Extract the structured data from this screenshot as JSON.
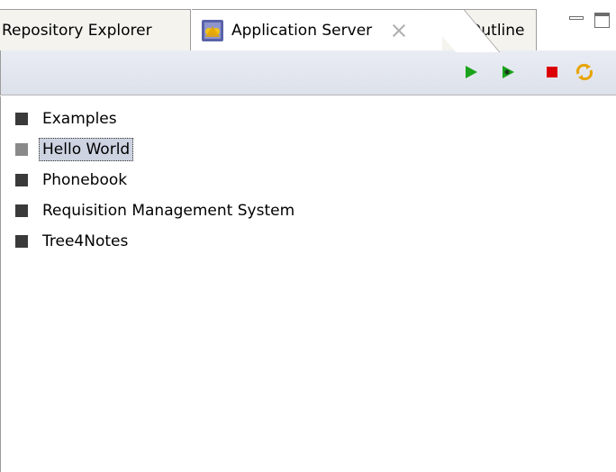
{
  "tabs": {
    "repository_explorer": "Repository Explorer",
    "application_server": "Application Server",
    "outline": "Outline"
  },
  "toolbar": {
    "icons": [
      "run-icon",
      "debug-icon",
      "stop-icon",
      "refresh-icon"
    ],
    "colors": {
      "run": "#1aa31a",
      "stop": "#dd0000",
      "refresh": "#e8a400"
    }
  },
  "tree": {
    "items": [
      {
        "label": "Examples",
        "selected": false
      },
      {
        "label": "Hello World",
        "selected": true
      },
      {
        "label": "Phonebook",
        "selected": false
      },
      {
        "label": "Requisition Management System",
        "selected": false
      },
      {
        "label": "Tree4Notes",
        "selected": false
      }
    ]
  }
}
